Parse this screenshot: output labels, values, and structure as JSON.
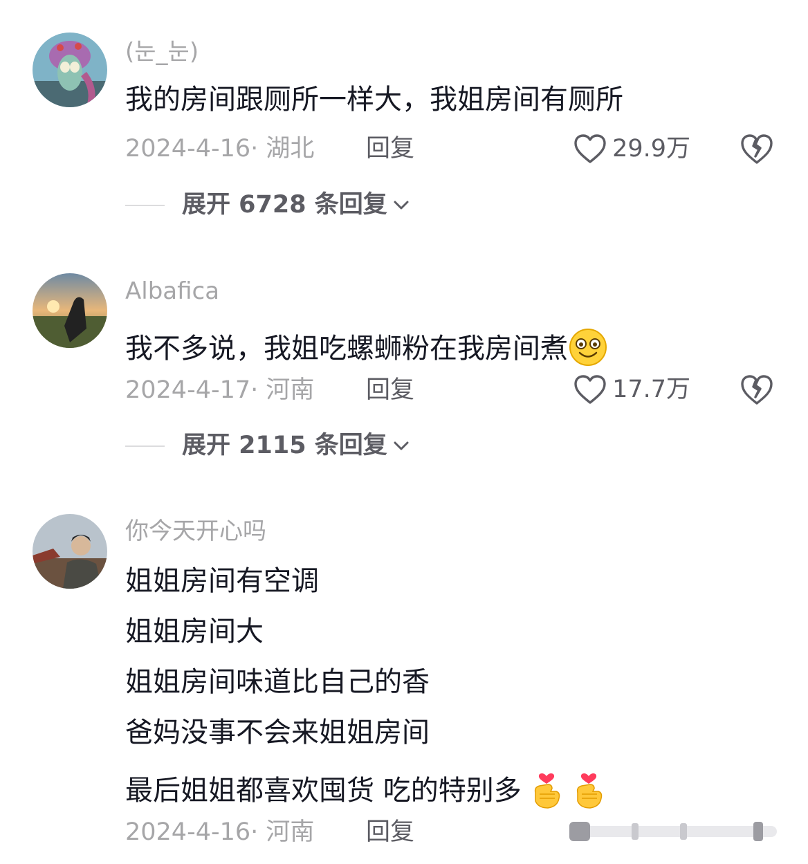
{
  "comments": [
    {
      "username": "(눈_눈)",
      "text": "我的房间跟厕所一样大，我姐房间有厕所",
      "meta": "2024-4-16· 湖北",
      "reply": "回复",
      "likes": "29.9万",
      "expand": "展开 6728 条回复"
    },
    {
      "username": "Albafica",
      "text": "我不多说，我姐吃螺蛳粉在我房间煮",
      "meta": "2024-4-17· 河南",
      "reply": "回复",
      "likes": "17.7万",
      "expand": "展开 2115 条回复"
    },
    {
      "username": "你今天开心吗",
      "lines": [
        "姐姐房间有空调",
        "姐姐房间大",
        "姐姐房间味道比自己的香",
        "爸妈没事不会来姐姐房间",
        "最后姐姐都喜欢囤货  吃的特别多"
      ],
      "meta": "2024-4-16· 河南",
      "reply": "回复"
    }
  ],
  "icons": {
    "like": "heart-outline-icon",
    "dislike": "broken-heart-icon",
    "expand_chevron": "chevron-down-icon",
    "emoji_smile": "smiling-face-emoji",
    "emoji_finger_heart": "finger-heart-emoji"
  },
  "colors": {
    "text": "#161823",
    "secondary": "#a6a6a8",
    "action": "#5c5c63"
  }
}
